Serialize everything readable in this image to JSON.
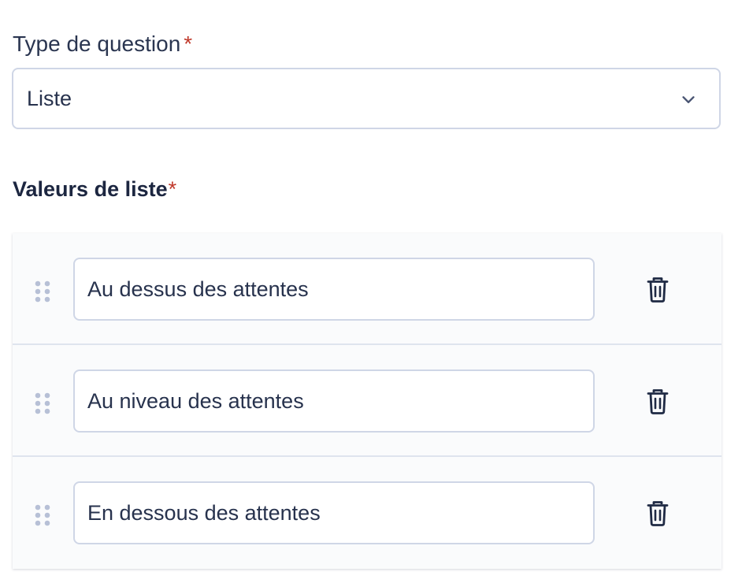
{
  "question_type": {
    "label": "Type de question",
    "required_marker": "*",
    "selected_value": "Liste",
    "icon": "chevron-down-icon"
  },
  "list_values": {
    "label": "Valeurs de liste",
    "required_marker": "*",
    "items": [
      {
        "value": "Au dessus des attentes"
      },
      {
        "value": "Au niveau des attentes"
      },
      {
        "value": "En dessous des attentes"
      }
    ],
    "drag_icon": "drag-handle-icon",
    "delete_icon": "trash-icon"
  },
  "colors": {
    "text": "#27324d",
    "required": "#c0392b",
    "border": "#cfd6e6",
    "icon": "#1f2a44",
    "handle": "#b7c0d6"
  }
}
